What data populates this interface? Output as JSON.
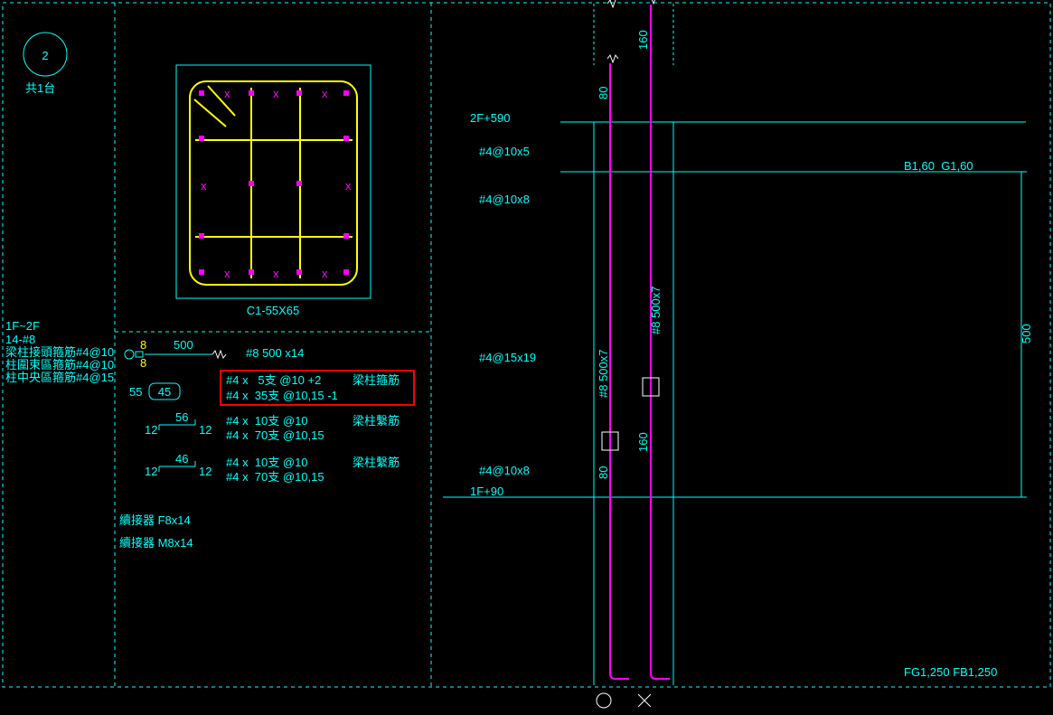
{
  "left": {
    "detail_num": "2",
    "detail_sub": "共1台",
    "range": "1F~2F",
    "bars": "14-#8",
    "note1": "梁柱接頭箍筋#4@10",
    "note2": "柱圍束區箍筋#4@10",
    "note3": "柱中央區箍筋#4@15",
    "section_label": "C1-55X65",
    "len500": "500",
    "b_top": "8",
    "b_bot": "8",
    "spec_main": "#8 500 x14",
    "dim55": "55",
    "dim45": "45",
    "rb1a": "#4 x   5支 @10 +2",
    "rb1a_lab": "梁柱箍筋",
    "rb1b": "#4 x  35支 @10,15 -1",
    "dim56": "56",
    "dim12a": "12",
    "dim12b": "12",
    "rb2a": "#4 x  10支 @10",
    "rb2a_lab": "梁柱繫筋",
    "rb2b": "#4 x  70支 @10,15",
    "dim46": "46",
    "dim12c": "12",
    "dim12d": "12",
    "rb3a": "#4 x  10支 @10",
    "rb3a_lab": "梁柱繫筋",
    "rb3b": "#4 x  70支 @10,15",
    "coupler1": "續接器 F8x14",
    "coupler2": "續接器 M8x14"
  },
  "right": {
    "lvl2": "2F+590",
    "lvl1": "1F+90",
    "t1": "#4@10x5",
    "t2": "#4@10x8",
    "t3": "#4@15x19",
    "t4": "#4@10x8",
    "beam_r": "B1,60  G1,60",
    "beam_b": "FG1,250 FB1,250",
    "d160a": "160",
    "d160b": "160",
    "d80a": "80",
    "d80b": "80",
    "d500": "500",
    "v1": "#8 500x7",
    "v2": "#8 500x7"
  }
}
